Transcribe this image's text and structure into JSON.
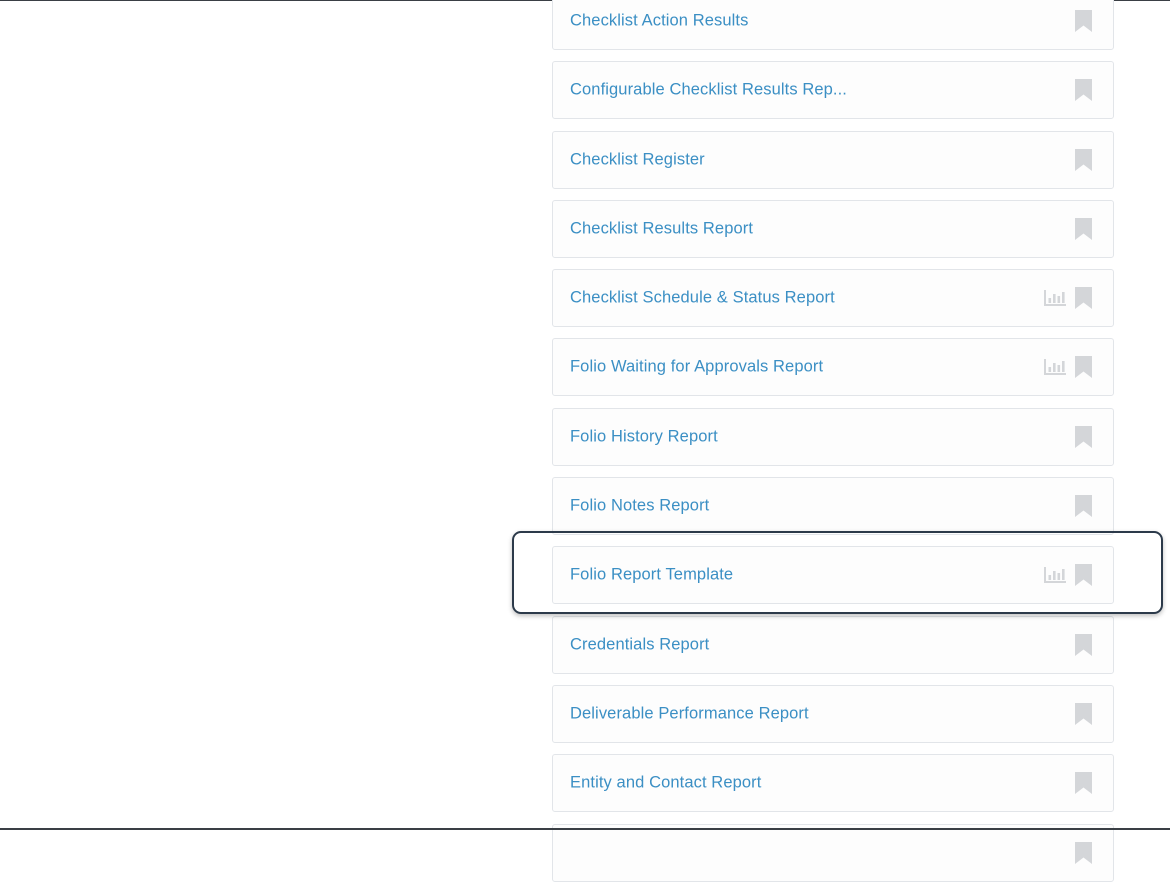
{
  "reports": [
    {
      "title": "Checklist Action Results",
      "has_chart": false
    },
    {
      "title": "Configurable Checklist Results Rep...",
      "has_chart": false
    },
    {
      "title": "Checklist Register",
      "has_chart": false
    },
    {
      "title": "Checklist Results Report",
      "has_chart": false
    },
    {
      "title": "Checklist Schedule & Status Report",
      "has_chart": true
    },
    {
      "title": "Folio Waiting for Approvals Report",
      "has_chart": true
    },
    {
      "title": "Folio History Report",
      "has_chart": false
    },
    {
      "title": "Folio Notes Report",
      "has_chart": false
    },
    {
      "title": "Folio Report Template",
      "has_chart": true
    },
    {
      "title": "Credentials Report",
      "has_chart": false
    },
    {
      "title": "Deliverable Performance Report",
      "has_chart": false
    },
    {
      "title": "Entity and Contact Report",
      "has_chart": false
    },
    {
      "title": "",
      "has_chart": false
    }
  ],
  "icons": {
    "chart": "bar-chart-icon",
    "bookmark": "bookmark-icon"
  },
  "colors": {
    "link_text": "#3b8fc4",
    "icon_gray": "#d4d6d9",
    "card_border": "#e2e5e9",
    "focus_ring": "#2c3a4a"
  },
  "focused_report": "Folio Report Template"
}
